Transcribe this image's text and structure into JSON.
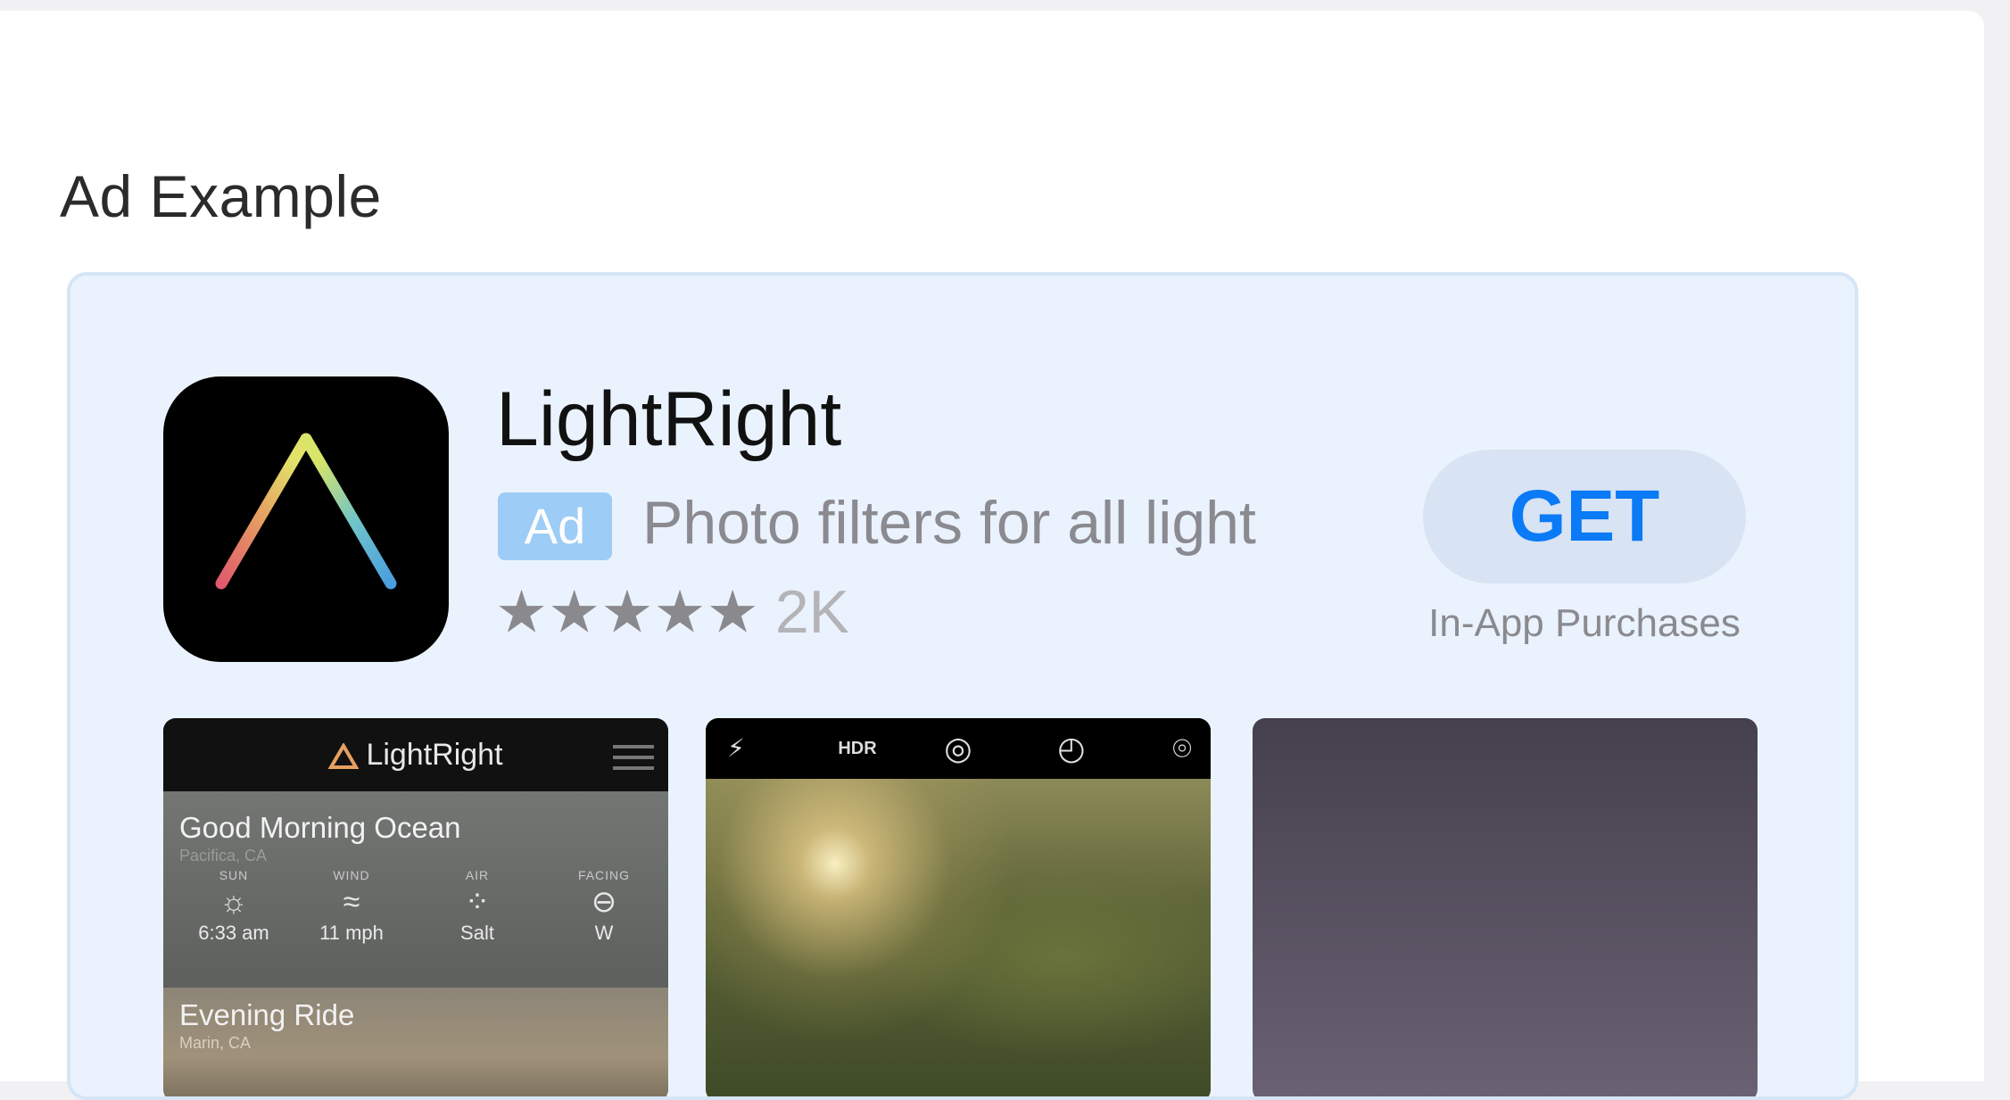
{
  "section": {
    "title": "Ad Example"
  },
  "app": {
    "name": "LightRight",
    "ad_badge": "Ad",
    "subtitle": "Photo filters for all light",
    "stars": "★★★★★",
    "rating_count": "2K",
    "get_label": "GET",
    "in_app_purchases": "In-App Purchases"
  },
  "screenshots": {
    "shot1": {
      "app_title": "LightRight",
      "card1_title": "Good Morning Ocean",
      "card1_location": "Pacifica, CA",
      "columns": [
        {
          "label": "SUN",
          "icon": "☼",
          "value": "6:33 am"
        },
        {
          "label": "WIND",
          "icon": "≈",
          "value": "11 mph"
        },
        {
          "label": "AIR",
          "icon": "⁘",
          "value": "Salt"
        },
        {
          "label": "FACING",
          "icon": "⊖",
          "value": "W"
        }
      ],
      "card2_title": "Evening Ride",
      "card2_location": "Marin, CA"
    },
    "shot2": {
      "toolbar": {
        "flash_off": "⚡",
        "hdr": "HDR",
        "live": "◎",
        "timer": "◴",
        "camera_flip": "⌾"
      }
    }
  },
  "colors": {
    "accent": "#0a7af7",
    "card_bg": "#eaf3fd",
    "ad_badge_bg": "#9dcdf6",
    "get_button_bg": "#d8e3f3"
  }
}
